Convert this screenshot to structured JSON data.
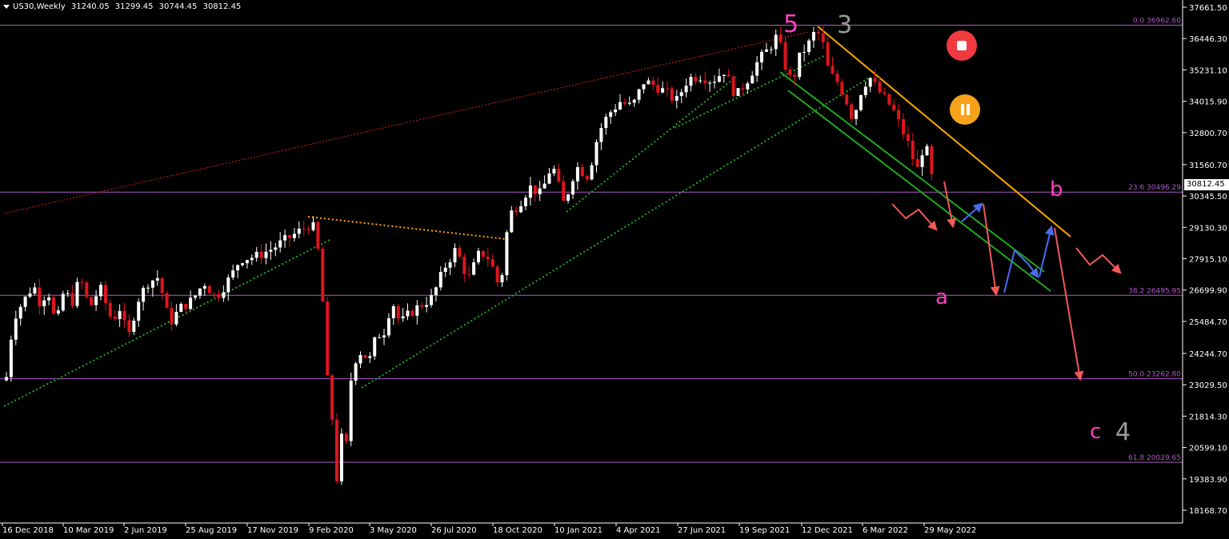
{
  "header": {
    "symbol": "US30,Weekly",
    "open": "31240.05",
    "high": "31299.45",
    "low": "30744.45",
    "close": "30812.45"
  },
  "current_price_label": "30812.45",
  "chart_data": {
    "type": "candlestick",
    "title": "US30,Weekly",
    "ylim": [
      17600,
      37900
    ],
    "y_ticks": [
      "37661.50",
      "36446.30",
      "35231.10",
      "34015.90",
      "32800.70",
      "31560.70",
      "30345.50",
      "29130.30",
      "27915.10",
      "26699.90",
      "25484.70",
      "24244.70",
      "23029.50",
      "21814.30",
      "20599.10",
      "19383.90",
      "18168.70"
    ],
    "x_ticks": [
      "16 Dec 2018",
      "10 Mar 2019",
      "2 Jun 2019",
      "25 Aug 2019",
      "17 Nov 2019",
      "9 Feb 2020",
      "3 May 2020",
      "26 Jul 2020",
      "18 Oct 2020",
      "10 Jan 2021",
      "4 Apr 2021",
      "27 Jun 2021",
      "19 Sep 2021",
      "12 Dec 2021",
      "6 Mar 2022",
      "29 May 2022"
    ],
    "fib_levels": [
      {
        "label": "0.0 36962.60",
        "value": 36962.6
      },
      {
        "label": "23.6 30496.29",
        "value": 30496.29
      },
      {
        "label": "38.2 26495.95",
        "value": 26495.95
      },
      {
        "label": "50.0 23262.80",
        "value": 23262.8
      },
      {
        "label": "61.8 20029.65",
        "value": 20029.65
      }
    ],
    "wave_labels": [
      {
        "text": "5",
        "color": "#ff3fbf"
      },
      {
        "text": "3",
        "color": "#9a9a9a"
      },
      {
        "text": "b",
        "color": "#ff3fbf"
      },
      {
        "text": "a",
        "color": "#ff3fbf"
      },
      {
        "text": "c",
        "color": "#ff3fbf"
      },
      {
        "text": "4",
        "color": "#9a9a9a"
      }
    ],
    "colors": {
      "bull": "#ffffff",
      "bear": "#e0141e",
      "fib": "#b157c9",
      "trend_dotted": "#1fa91f",
      "resistance": "#ffa500",
      "channel": "#1fa91f",
      "forecast_down": "#f25a5a",
      "forecast_up": "#4a6df0",
      "axis_text": "#ffffff"
    }
  }
}
